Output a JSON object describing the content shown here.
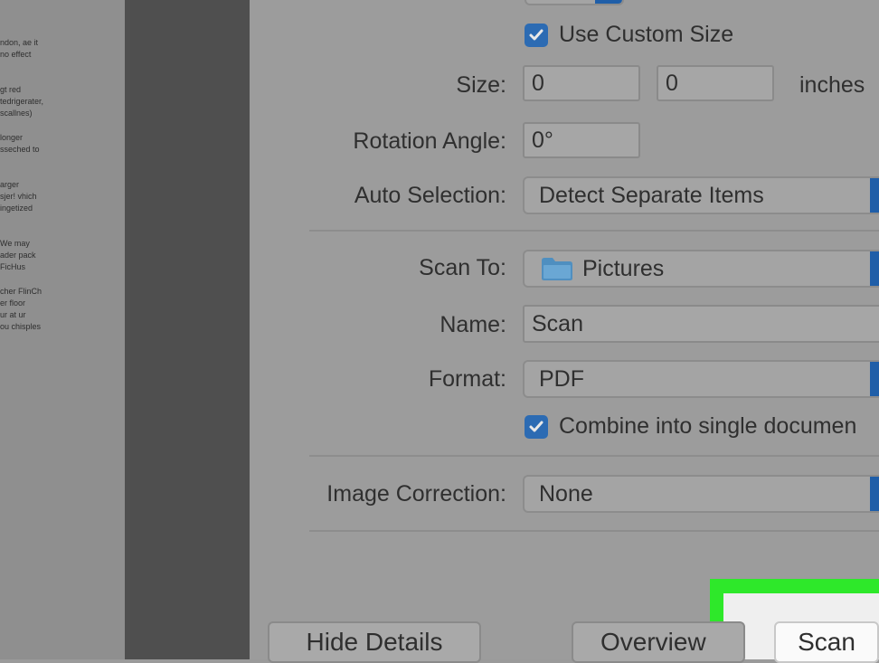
{
  "colors": {
    "accent_blue": "#2c6bb3",
    "highlight_green": "#2ee82a"
  },
  "preview": {
    "text_fragments": [
      "ndon, ae it",
      "no effect",
      "gt red",
      "tedrigerater,",
      "scallnes)",
      "longer",
      "sseched to",
      "arger",
      "sjer! vhich",
      "ingetized",
      "We may",
      "ader pack",
      "FicHus",
      "cher FlinCh",
      "er floor",
      "ur at ur",
      "ou chisples"
    ]
  },
  "form": {
    "custom_size_checkbox_label": "Use Custom Size",
    "custom_size_checked": true,
    "size_label": "Size:",
    "size_width": "0",
    "size_height": "0",
    "size_unit": "inches",
    "rotation_label": "Rotation Angle:",
    "rotation_value": "0°",
    "auto_selection_label": "Auto Selection:",
    "auto_selection_value": "Detect Separate Items",
    "scan_to_label": "Scan To:",
    "scan_to_value": "Pictures",
    "name_label": "Name:",
    "name_value": "Scan",
    "format_label": "Format:",
    "format_value": "PDF",
    "combine_checkbox_label": "Combine into single documen",
    "combine_checked": true,
    "image_correction_label": "Image Correction:",
    "image_correction_value": "None"
  },
  "buttons": {
    "hide_details": "Hide Details",
    "overview": "Overview",
    "scan": "Scan"
  }
}
